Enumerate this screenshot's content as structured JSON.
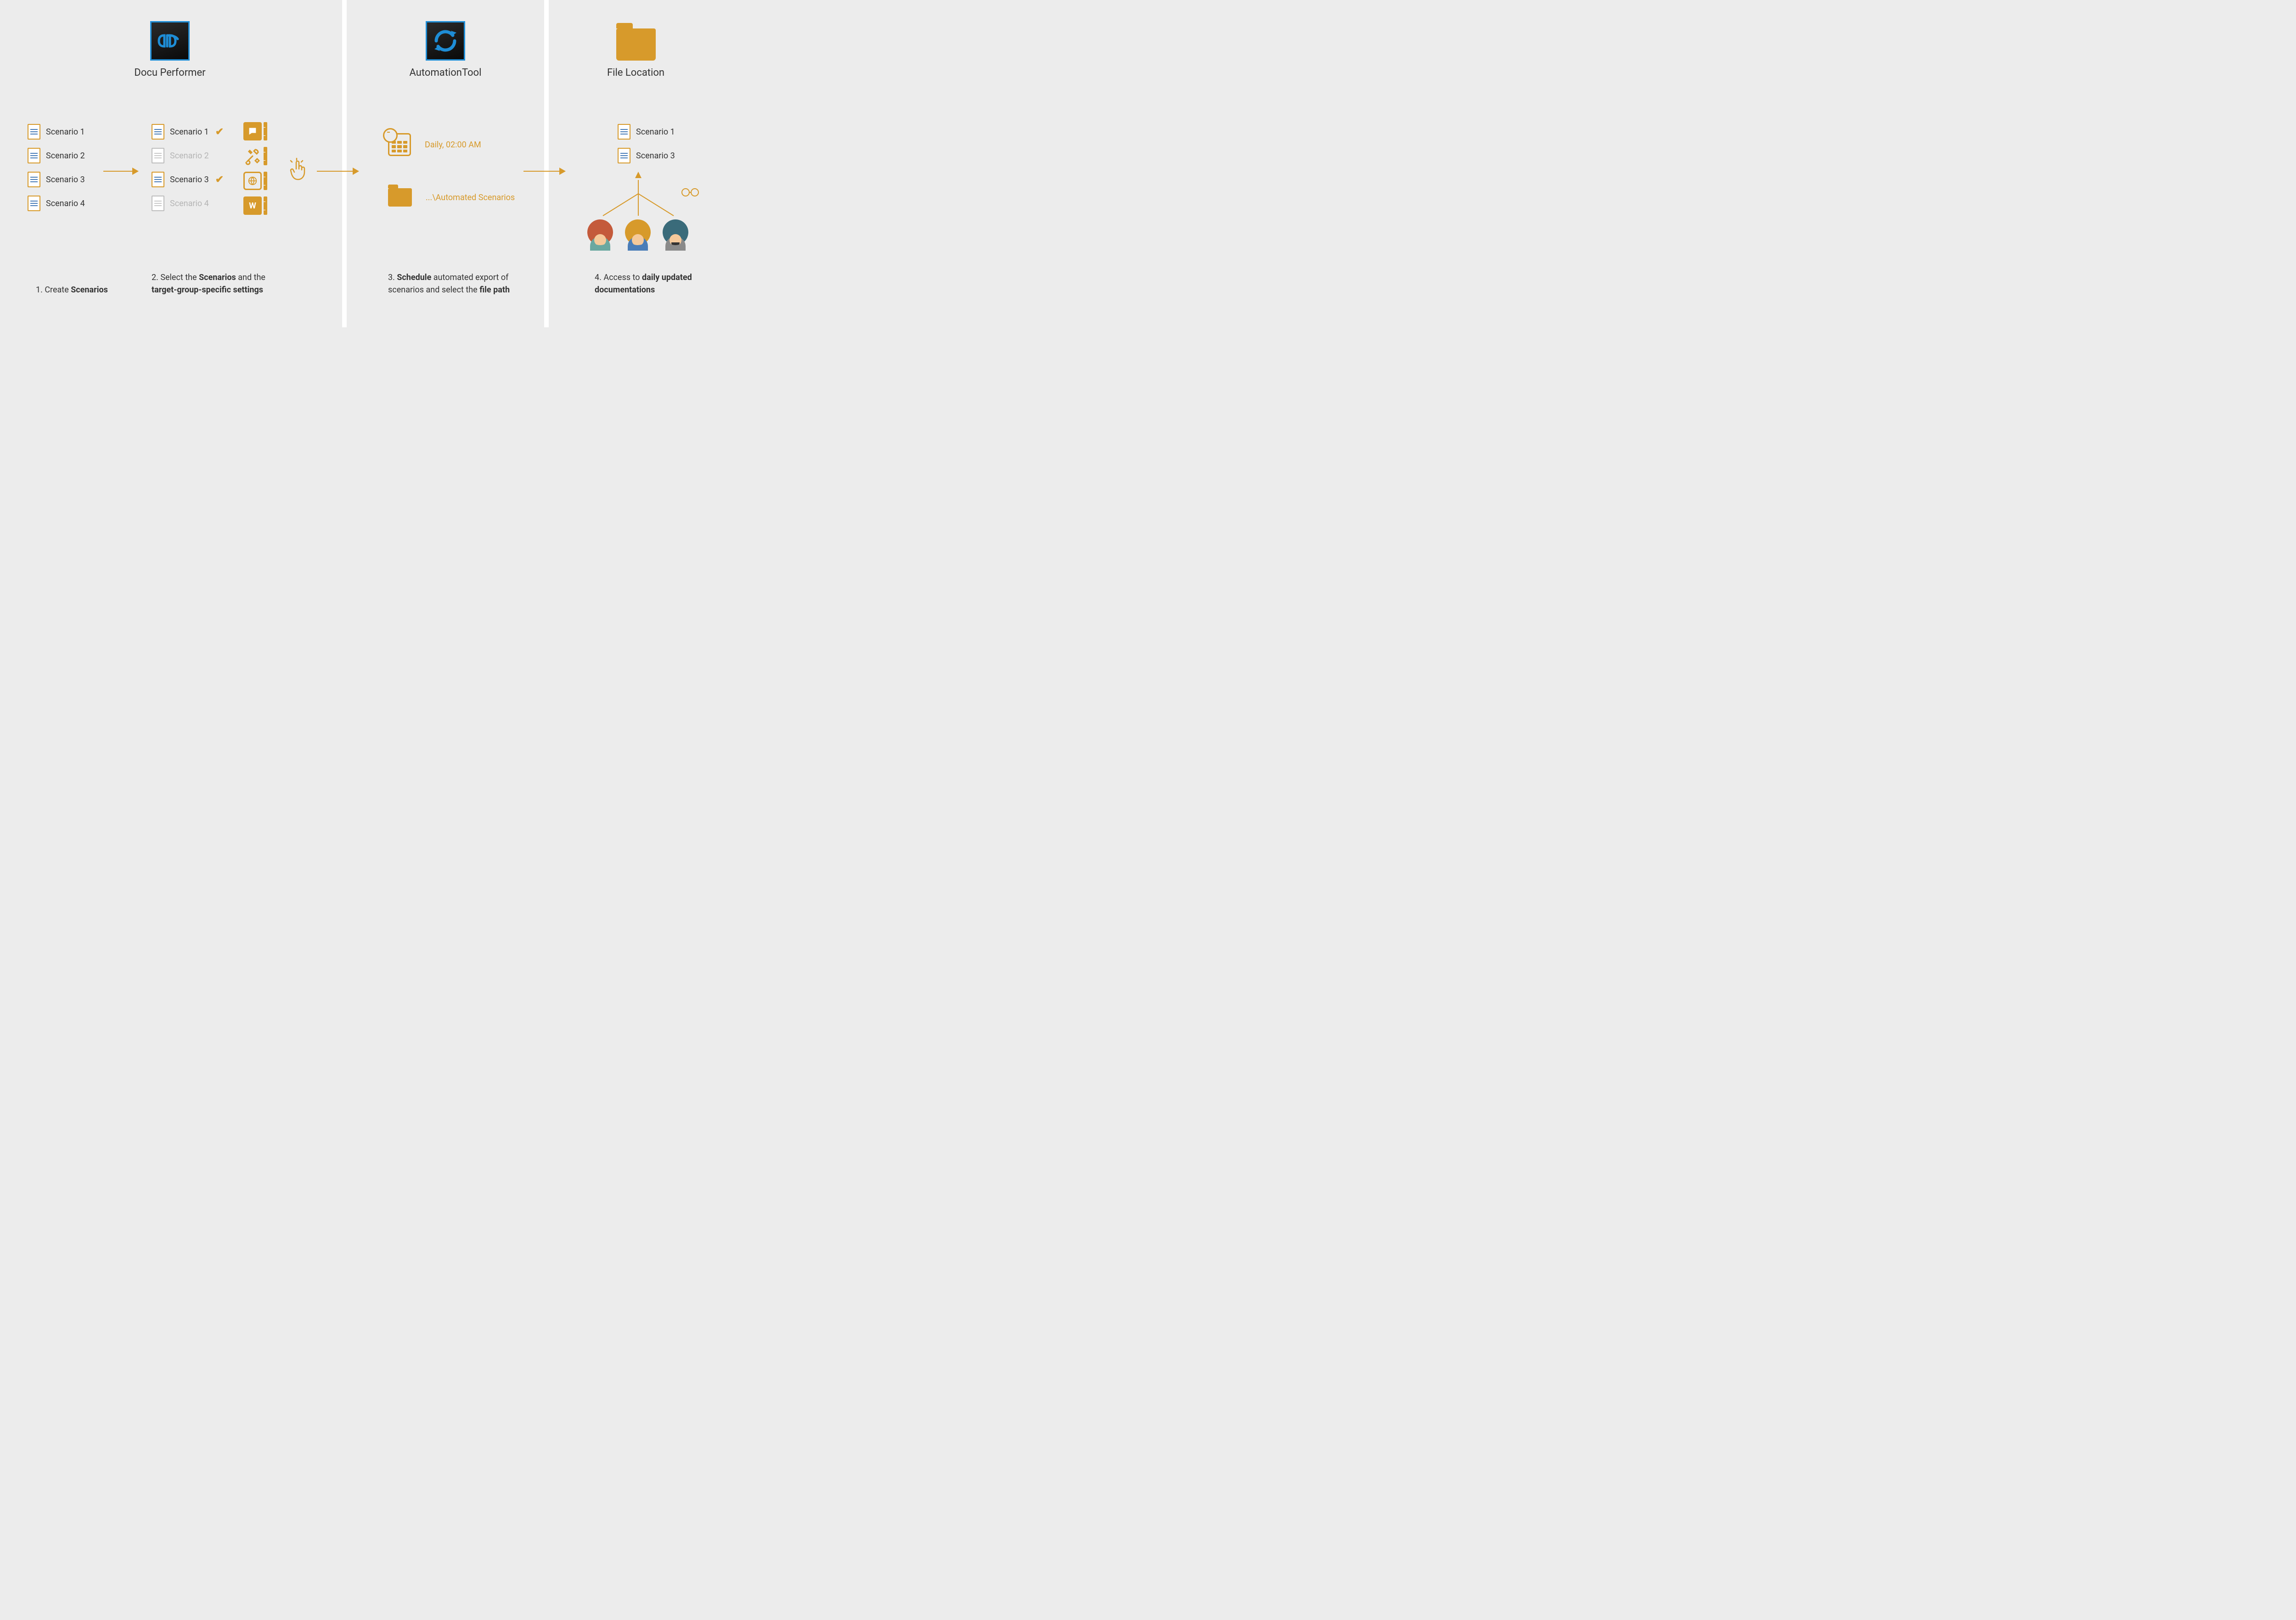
{
  "panel1": {
    "app_title": "Docu Performer",
    "scenarios_left": [
      "Scenario 1",
      "Scenario 2",
      "Scenario 3",
      "Scenario 4"
    ],
    "scenarios_right": [
      {
        "label": "Scenario 1",
        "selected": true
      },
      {
        "label": "Scenario 2",
        "selected": false
      },
      {
        "label": "Scenario 3",
        "selected": true
      },
      {
        "label": "Scenario 4",
        "selected": false
      }
    ],
    "step1_prefix": "1. Create ",
    "step1_bold": "Scenarios",
    "step2_prefix": "2. Select the ",
    "step2_bold1": "Scenarios",
    "step2_mid": " and the ",
    "step2_bold2": "target-group-specific settings"
  },
  "panel2": {
    "app_title": "AutomationTool",
    "schedule_text": "Daily, 02:00 AM",
    "path_text": "...\\Automated Scenarios",
    "step3_prefix": "3. ",
    "step3_bold1": "Schedule",
    "step3_mid": " automated export of scenarios and select the ",
    "step3_bold2": "file path"
  },
  "panel3": {
    "title": "File Location",
    "output_scenarios": [
      "Scenario 1",
      "Scenario 3"
    ],
    "step4_prefix": "4. Access to ",
    "step4_bold": "daily updated documentations"
  },
  "colors": {
    "accent": "#d79a2b",
    "blue": "#1e8dd6"
  }
}
